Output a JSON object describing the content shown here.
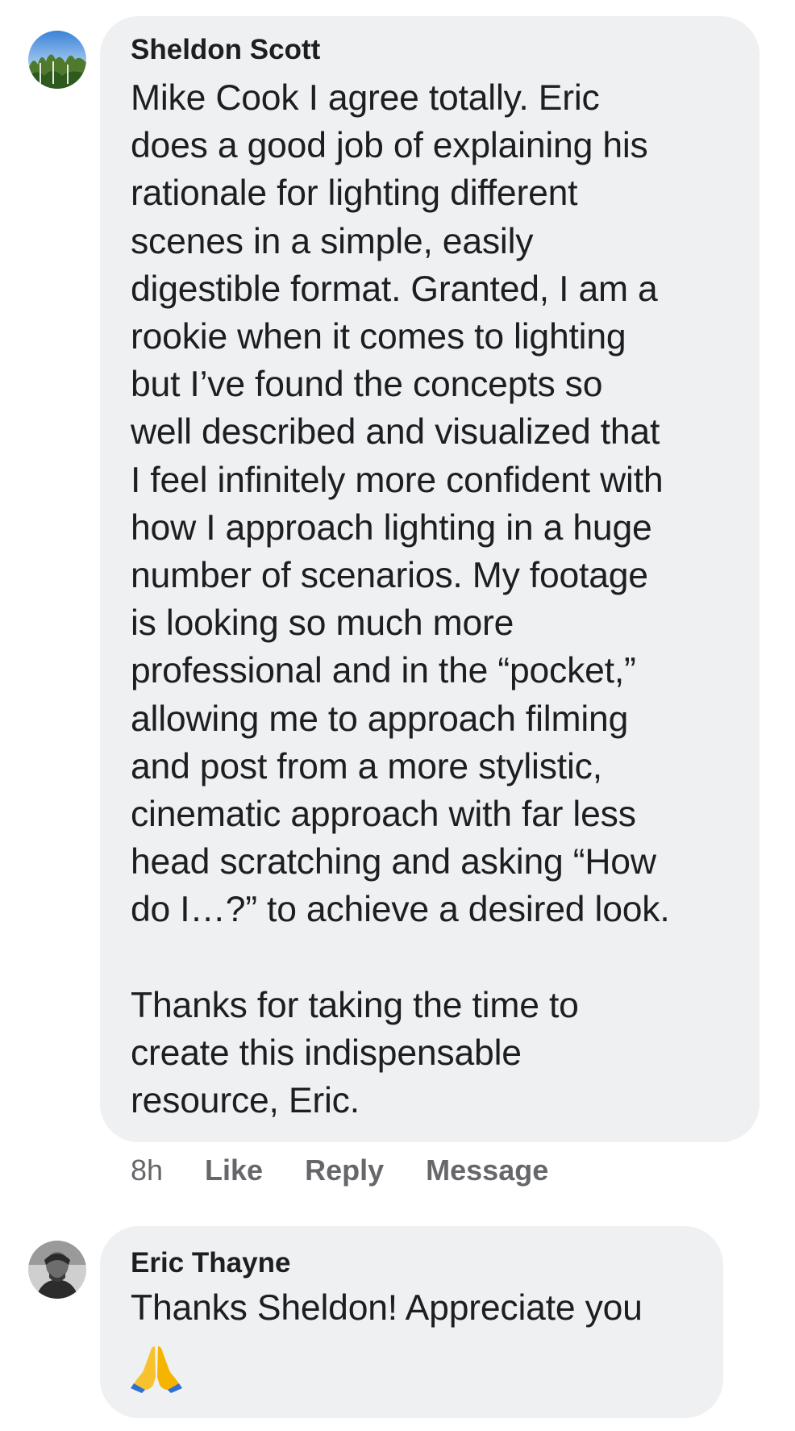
{
  "comments": [
    {
      "author": "Sheldon Scott",
      "avatar_icon": "profile-photo-trees-sky",
      "body": "Mike Cook I agree totally. Eric\ndoes a good job of explaining his\nrationale for lighting different\nscenes in a simple, easily\ndigestible format. Granted, I am a\nrookie when it comes to lighting\nbut I’ve found the concepts so\nwell described and visualized that\nI feel infinitely more confident with\nhow I approach lighting in a huge\nnumber of scenarios. My footage\nis looking so much more\nprofessional and in the “pocket,”\nallowing me to approach filming\nand post from a more stylistic,\ncinematic approach with far less\nhead scratching and asking “How\ndo I…?” to achieve a desired look.\n\nThanks for taking the time to\ncreate this indispensable\nresource, Eric.",
      "actions": {
        "time": "8h",
        "like": "Like",
        "reply": "Reply",
        "message": "Message"
      }
    },
    {
      "author": "Eric Thayne",
      "avatar_icon": "profile-photo-man-grayscale",
      "body": "Thanks Sheldon! Appreciate you",
      "emoji_icon": "folded-hands-emoji"
    }
  ],
  "colors": {
    "bubble": "#eff0f2",
    "text": "#1c1e21",
    "meta": "#65676b"
  }
}
